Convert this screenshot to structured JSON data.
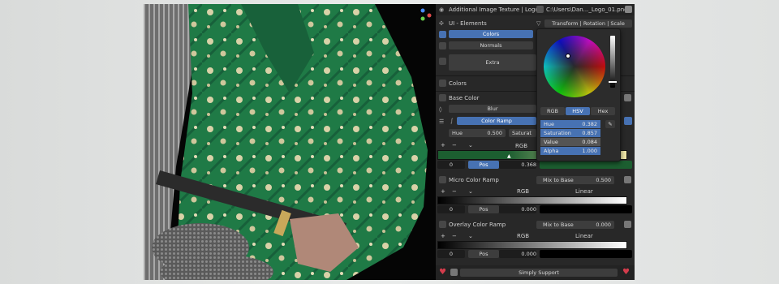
{
  "panel": {
    "top_bar": {
      "label": "Additional Image Texture | Logo",
      "file": "C:\\Users\\Dan..._Logo_01.png"
    },
    "ui_elements": {
      "title": "UI - Elements",
      "transform_label": "Transform | Rotation | Scale",
      "colors_label": "Colors",
      "normals_label": "Normals",
      "extra_label": "Extra"
    },
    "colors_section": {
      "title": "Colors"
    },
    "base_color": {
      "title": "Base Color",
      "blur_label": "Blur",
      "color_ramp_label": "Color Ramp",
      "hue_label": "Hue",
      "hue_value": "0.500",
      "saturation_label": "Saturat",
      "interp_label": "RGB",
      "stop_index": "0",
      "pos_label": "Pos",
      "pos_value": "0.368",
      "ramp_colors": [
        "#1c5e30",
        "#f0e6a8"
      ]
    },
    "micro_ramp": {
      "title": "Micro Color Ramp",
      "mix_label": "Mix to Base",
      "mix_value": "0.500",
      "mode": "RGB",
      "interp": "Linear",
      "stop_index": "0",
      "pos_label": "Pos",
      "pos_value": "0.000"
    },
    "overlay_ramp": {
      "title": "Overlay Color Ramp",
      "mix_label": "Mix to Base",
      "mix_value": "0.000",
      "mode": "RGB",
      "interp": "Linear",
      "stop_index": "0",
      "pos_label": "Pos",
      "pos_value": "0.000"
    },
    "footer": {
      "support_label": "Simply Support"
    }
  },
  "color_picker": {
    "tabs": [
      "RGB",
      "HSV",
      "Hex"
    ],
    "active_tab": "HSV",
    "fields": [
      {
        "label": "Hue",
        "value": "0.382"
      },
      {
        "label": "Saturation",
        "value": "0.857"
      },
      {
        "label": "Value",
        "value": "0.084"
      },
      {
        "label": "Alpha",
        "value": "1.000"
      }
    ]
  },
  "colors": {
    "accent": "#4772b3",
    "heart": "#d43c4c",
    "panel_bg": "#282828",
    "kimono_green": "#1f7a46"
  }
}
